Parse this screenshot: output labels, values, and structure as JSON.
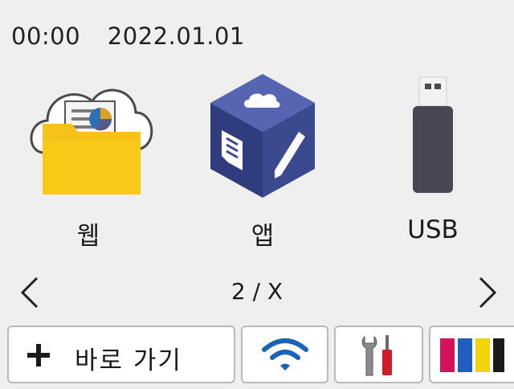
{
  "status": {
    "time": "00:00",
    "date": "2022.01.01"
  },
  "tiles": [
    {
      "label": "웹",
      "icon": "web-folder-cloud-icon"
    },
    {
      "label": "앱",
      "icon": "apps-cube-icon"
    },
    {
      "label": "USB",
      "icon": "usb-drive-icon"
    }
  ],
  "pager": {
    "indicator": "2 / X"
  },
  "bottom": {
    "shortcut_label": "바로 가기",
    "shortcut_icon": "plus-icon",
    "wifi_icon": "wifi-icon",
    "settings_icon": "settings-tools-icon",
    "toner_icon": "toner-ink-icon"
  },
  "colors": {
    "folder": "#f7c31b",
    "cube_dark": "#3b4a8f",
    "cube_top": "#5665b1",
    "usb_body": "#4a4654",
    "wifi": "#1a64b8",
    "toner": [
      "#d4135e",
      "#1f5fbf",
      "#f2d40a",
      "#1a1a1a"
    ]
  }
}
